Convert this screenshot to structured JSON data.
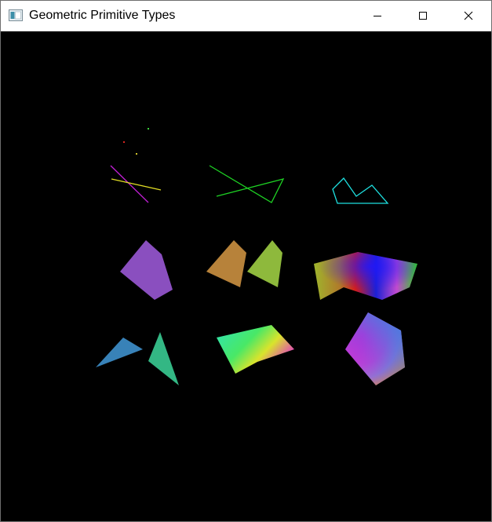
{
  "window": {
    "title": "Geometric Primitive Types",
    "icon": "app-window-icon",
    "controls": {
      "minimize": "minimize-icon",
      "maximize": "maximize-icon",
      "close": "close-icon"
    }
  },
  "canvas": {
    "background": "#000000",
    "primitives": [
      "points",
      "lines",
      "line-strip",
      "line-loop",
      "polygon",
      "quads",
      "quad-strip",
      "triangles",
      "triangle-strip",
      "triangle-fan"
    ]
  }
}
